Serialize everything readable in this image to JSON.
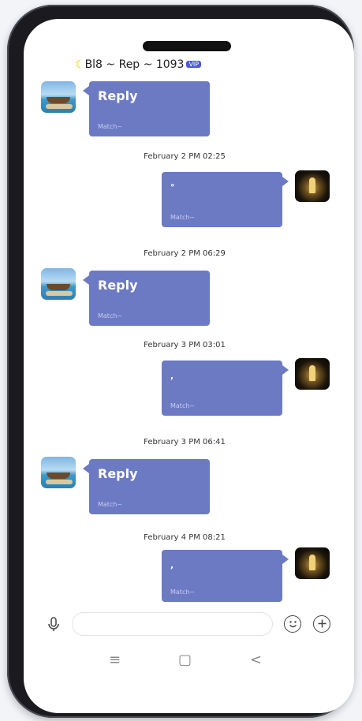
{
  "header": {
    "title": "Bl8 ~ Rep ~ 1093",
    "moon": "☾",
    "badge": "VIP"
  },
  "messages": [
    {
      "side": "left",
      "avatar": "beach-boat-avatar",
      "text": "Reply",
      "sub": "Match~"
    },
    {
      "timestamp": "February 2 PM 02:25"
    },
    {
      "side": "right",
      "avatar": "golden-clock-avatar",
      "text": "°",
      "sub": "Match~"
    },
    {
      "timestamp": "February 2 PM 06:29"
    },
    {
      "side": "left",
      "avatar": "beach-boat-avatar",
      "text": "Reply",
      "sub": "Match~"
    },
    {
      "timestamp": "February 3 PM 03:01"
    },
    {
      "side": "right",
      "avatar": "golden-clock-avatar",
      "text": ",",
      "sub": "Match~"
    },
    {
      "timestamp": "February 3 PM 06:41"
    },
    {
      "side": "left",
      "avatar": "beach-boat-avatar",
      "text": "Reply",
      "sub": "Match~"
    },
    {
      "timestamp": "February 4 PM 08:21"
    },
    {
      "side": "right",
      "avatar": "golden-clock-avatar",
      "text": ",",
      "sub": "Match~"
    }
  ],
  "input": {
    "value": "",
    "placeholder": ""
  },
  "icons": {
    "mic": "microphone-icon",
    "emoji": "smiley-icon",
    "add": "plus-circle-icon"
  },
  "nav": {
    "recents": "≡",
    "home": "▢",
    "back": "<"
  },
  "colors": {
    "bubble": "#6c7ac4",
    "vip_badge": "#4a5bd4",
    "moon": "#f5c400"
  }
}
